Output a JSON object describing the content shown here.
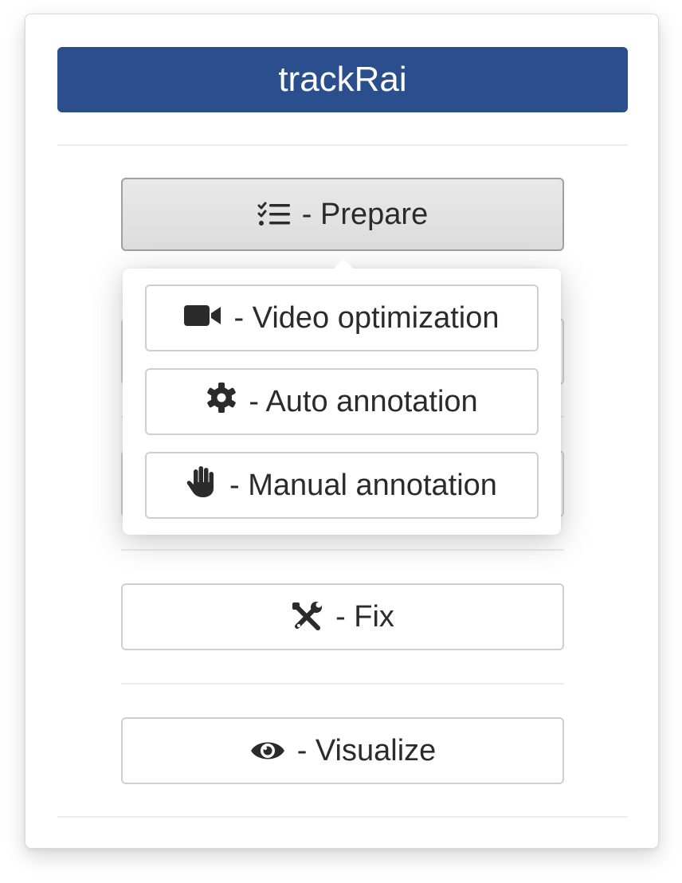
{
  "app": {
    "title": "trackRai"
  },
  "menu": {
    "prepare": {
      "label": "- Prepare",
      "icon": "list-check-icon"
    },
    "fix": {
      "label": "- Fix",
      "icon": "tools-icon"
    },
    "visualize": {
      "label": "- Visualize",
      "icon": "eye-icon"
    }
  },
  "prepare_popover": {
    "items": [
      {
        "label": "- Video optimization",
        "icon": "video-camera-icon"
      },
      {
        "label": "- Auto annotation",
        "icon": "gear-icon"
      },
      {
        "label": "- Manual annotation",
        "icon": "hand-icon"
      }
    ]
  },
  "colors": {
    "title_bg": "#2b4f8d",
    "title_text": "#ffffff",
    "button_text": "#2b2b2b",
    "active_button_bg": "#dcdcdc"
  }
}
